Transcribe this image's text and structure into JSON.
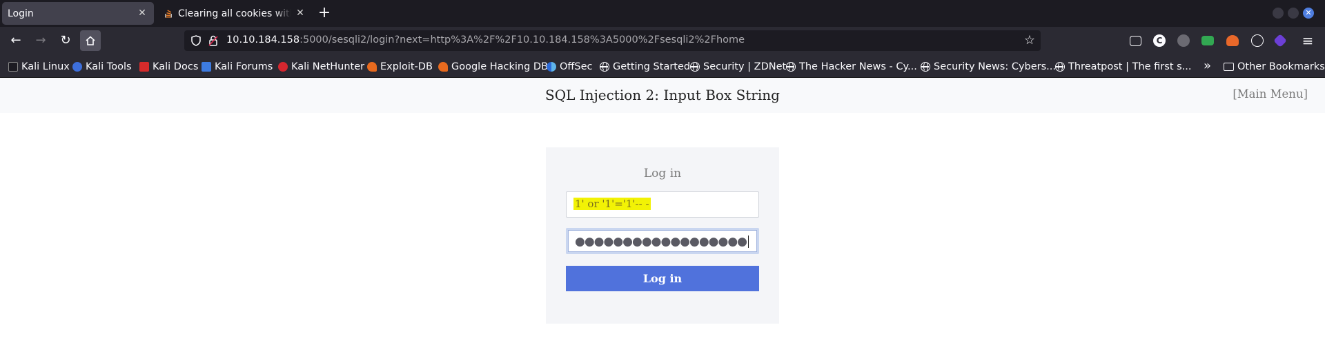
{
  "tabs": [
    {
      "label": "Login",
      "active": true
    },
    {
      "label": "Clearing all cookies with JavaScript",
      "active": false
    }
  ],
  "urlbar": {
    "host": "10.10.184.158",
    "rest": ":5000/sesqli2/login?next=http%3A%2F%2F10.10.184.158%3A5000%2Fsesqli2%2Fhome"
  },
  "bookmarks": [
    {
      "label": "Kali Linux",
      "icon": "kali-dragon-icon"
    },
    {
      "label": "Kali Tools",
      "icon": "kali-tools-icon"
    },
    {
      "label": "Kali Docs",
      "icon": "kali-docs-icon"
    },
    {
      "label": "Kali Forums",
      "icon": "kali-forums-icon"
    },
    {
      "label": "Kali NetHunter",
      "icon": "nethunter-icon"
    },
    {
      "label": "Exploit-DB",
      "icon": "exploit-db-icon"
    },
    {
      "label": "Google Hacking DB",
      "icon": "ghdb-icon"
    },
    {
      "label": "OffSec",
      "icon": "offsec-icon"
    },
    {
      "label": "Getting Started",
      "icon": "globe-icon"
    },
    {
      "label": "Security | ZDNet",
      "icon": "globe-icon"
    },
    {
      "label": "The Hacker News - Cy...",
      "icon": "globe-icon"
    },
    {
      "label": "Security News: Cybers...",
      "icon": "globe-icon"
    },
    {
      "label": "Threatpost | The first s...",
      "icon": "globe-icon"
    }
  ],
  "other_bookmarks": "Other Bookmarks",
  "page": {
    "title": "SQL Injection 2: Input Box String",
    "main_menu": "[Main Menu]",
    "form": {
      "heading": "Log in",
      "username_value": "1' or '1'='1'-- -",
      "password_masked": "●●●●●●●●●●●●●●●●●●",
      "button_label": "Log in"
    }
  },
  "colors": {
    "accent": "#5072dc",
    "highlight": "#f2f205"
  }
}
